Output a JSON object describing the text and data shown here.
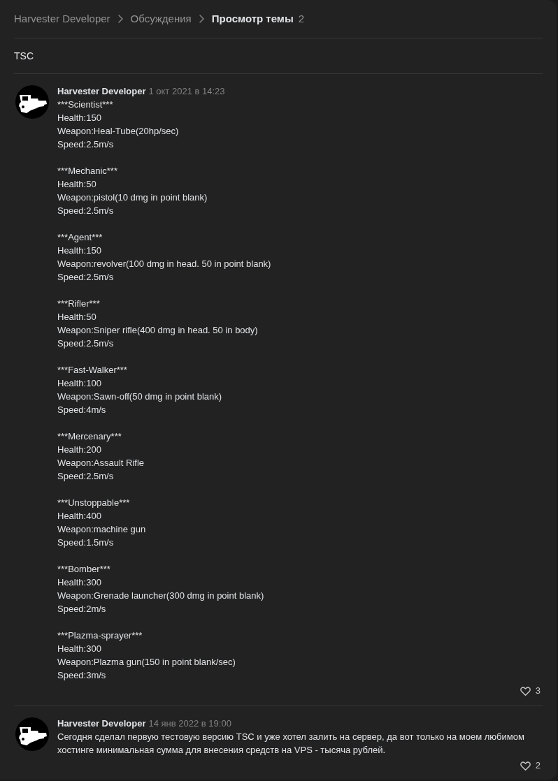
{
  "breadcrumb": {
    "items": [
      {
        "label": "Harvester Developer"
      },
      {
        "label": "Обсуждения"
      }
    ],
    "current": "Просмотр темы",
    "count": "2"
  },
  "topic": {
    "title": "TSC"
  },
  "posts": [
    {
      "author": "Harvester Developer",
      "date": "1 окт 2021 в 14:23",
      "paragraphs": [
        [
          "***Scientist***",
          "Health:150",
          "Weapon:Heal-Tube(20hp/sec)",
          "Speed:2.5m/s"
        ],
        [
          "***Mechanic***",
          "Health:50",
          "Weapon:pistol(10 dmg in point blank)",
          "Speed:2.5m/s"
        ],
        [
          "***Agent***",
          "Health:150",
          "Weapon:revolver(100 dmg in head. 50 in point blank)",
          "Speed:2.5m/s"
        ],
        [
          "***Rifler***",
          "Health:50",
          "Weapon:Sniper rifle(400 dmg in head. 50 in body)",
          "Speed:2.5m/s"
        ],
        [
          "***Fast-Walker***",
          "Health:100",
          "Weapon:Sawn-off(50 dmg in point blank)",
          "Speed:4m/s"
        ],
        [
          "***Mercenary***",
          "Health:200",
          "Weapon:Assault Rifle",
          "Speed:2.5m/s"
        ],
        [
          "***Unstoppable***",
          "Health:400",
          "Weapon:machine gun",
          "Speed:1.5m/s"
        ],
        [
          "***Bomber***",
          "Health:300",
          "Weapon:Grenade launcher(300 dmg in point blank)",
          "Speed:2m/s"
        ],
        [
          "***Plazma-sprayer***",
          "Health:300",
          "Weapon:Plazma gun(150 in point blank/sec)",
          "Speed:3m/s"
        ]
      ],
      "likes": "3"
    },
    {
      "author": "Harvester Developer",
      "date": "14 янв 2022 в 19:00",
      "paragraphs": [
        [
          "Сегодня сделал первую тестовую версию TSC и уже хотел залить на сервер, да вот только на моем любимом хостинге минимальная сумма для внесения средств на VPS - тысяча рублей."
        ]
      ],
      "likes": "2"
    }
  ]
}
